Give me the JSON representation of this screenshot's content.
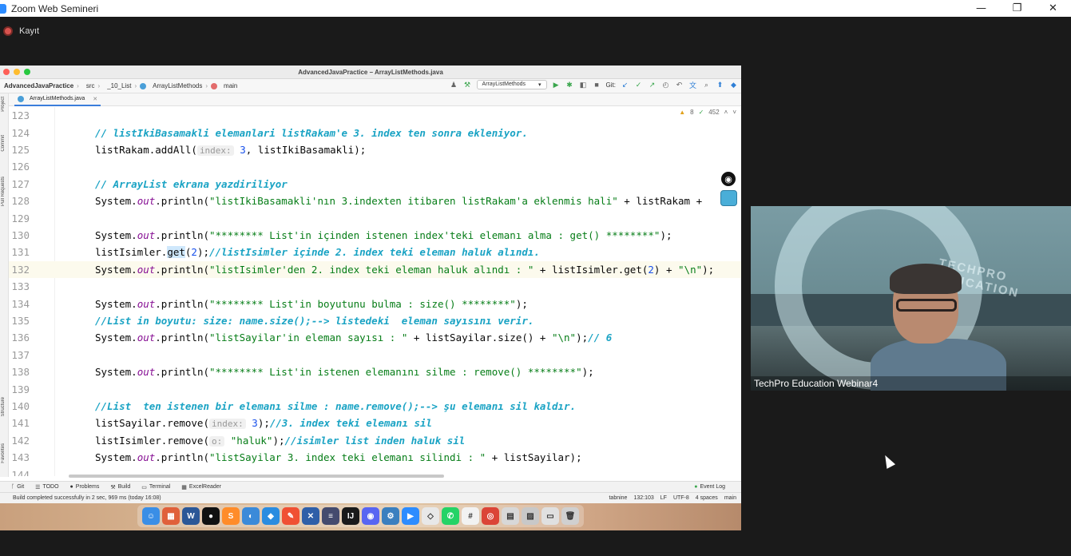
{
  "zoom": {
    "title": "Zoom Web Semineri",
    "recording_label": "Kayıt",
    "controls": [
      "—",
      "❐",
      "✕"
    ]
  },
  "ide": {
    "window_title": "AdvancedJavaPractice – ArrayListMethods.java",
    "breadcrumbs": {
      "project": "AdvancedJavaPractice",
      "src": "src",
      "package": "_10_List",
      "class": "ArrayListMethods",
      "method": "main"
    },
    "run_config": "ArrayListMethods",
    "git_label": "Git:",
    "open_tab": "ArrayListMethods.java",
    "inspections": {
      "warnings": "8",
      "ok": "452"
    },
    "left_strip": [
      "Project",
      "Commit",
      "Pull Requests",
      "Structure",
      "Favorites"
    ],
    "bottom_tabs": [
      "Git",
      "TODO",
      "Problems",
      "Build",
      "Terminal",
      "ExcelReader"
    ],
    "event_log": "Event Log",
    "status": {
      "message": "Build completed successfully in 2 sec, 969 ms (today 16:08)",
      "tabnine": "tabnine",
      "position": "132:103",
      "line_sep": "LF",
      "encoding": "UTF-8",
      "indent": "4 spaces",
      "branch": "main"
    },
    "code_lines": [
      {
        "n": "123",
        "parts": []
      },
      {
        "n": "124",
        "parts": [
          {
            "t": "// listIkiBasamakli elemanlari listRakam'e 3. index ten sonra ekleniyor.",
            "c": "cmt"
          }
        ]
      },
      {
        "n": "125",
        "parts": [
          {
            "t": "listRakam.addAll(",
            "c": ""
          },
          {
            "t": "index:",
            "c": "hint"
          },
          {
            "t": " 3",
            "c": "num"
          },
          {
            "t": ", listIkiBasamakli);",
            "c": ""
          }
        ]
      },
      {
        "n": "126",
        "parts": []
      },
      {
        "n": "127",
        "parts": [
          {
            "t": "// ArrayList ekrana yazdiriliyor",
            "c": "cmt"
          }
        ]
      },
      {
        "n": "128",
        "parts": [
          {
            "t": "System.",
            "c": ""
          },
          {
            "t": "out",
            "c": "fld"
          },
          {
            "t": ".println(",
            "c": ""
          },
          {
            "t": "\"listIkiBasamakli'nın 3.indexten itibaren listRakam'a eklenmis hali\"",
            "c": "str"
          },
          {
            "t": " + listRakam +",
            "c": ""
          }
        ]
      },
      {
        "n": "129",
        "parts": []
      },
      {
        "n": "130",
        "parts": [
          {
            "t": "System.",
            "c": ""
          },
          {
            "t": "out",
            "c": "fld"
          },
          {
            "t": ".println(",
            "c": ""
          },
          {
            "t": "\"******** List'in içinden istenen index'teki elemanı alma : get() ********\"",
            "c": "str"
          },
          {
            "t": ");",
            "c": ""
          }
        ]
      },
      {
        "n": "131",
        "parts": [
          {
            "t": "listIsimler.",
            "c": ""
          },
          {
            "t": "get",
            "c": "paren-hl"
          },
          {
            "t": "(",
            "c": ""
          },
          {
            "t": "2",
            "c": "num"
          },
          {
            "t": ");",
            "c": ""
          },
          {
            "t": "//listIsimler içinde 2. index teki eleman haluk alındı.",
            "c": "cmt"
          }
        ]
      },
      {
        "n": "132",
        "parts": [
          {
            "t": "System.",
            "c": ""
          },
          {
            "t": "out",
            "c": "fld"
          },
          {
            "t": ".println(",
            "c": ""
          },
          {
            "t": "\"listIsimler'den 2. index teki eleman haluk alındı : \"",
            "c": "str"
          },
          {
            "t": " + listIsimler.get(",
            "c": ""
          },
          {
            "t": "2",
            "c": "num"
          },
          {
            "t": ") + ",
            "c": ""
          },
          {
            "t": "\"\\n\"",
            "c": "str"
          },
          {
            "t": ");",
            "c": ""
          }
        ]
      },
      {
        "n": "133",
        "parts": []
      },
      {
        "n": "134",
        "parts": [
          {
            "t": "System.",
            "c": ""
          },
          {
            "t": "out",
            "c": "fld"
          },
          {
            "t": ".println(",
            "c": ""
          },
          {
            "t": "\"******** List'in boyutunu bulma : size() ********\"",
            "c": "str"
          },
          {
            "t": ");",
            "c": ""
          }
        ]
      },
      {
        "n": "135",
        "parts": [
          {
            "t": "//List in boyutu: size: name.size();--> listedeki  eleman sayısını verir.",
            "c": "cmt"
          }
        ]
      },
      {
        "n": "136",
        "parts": [
          {
            "t": "System.",
            "c": ""
          },
          {
            "t": "out",
            "c": "fld"
          },
          {
            "t": ".println(",
            "c": ""
          },
          {
            "t": "\"listSayilar'in eleman sayısı : \"",
            "c": "str"
          },
          {
            "t": " + listSayilar.size() + ",
            "c": ""
          },
          {
            "t": "\"\\n\"",
            "c": "str"
          },
          {
            "t": ");",
            "c": ""
          },
          {
            "t": "// 6",
            "c": "cmt"
          }
        ]
      },
      {
        "n": "137",
        "parts": []
      },
      {
        "n": "138",
        "parts": [
          {
            "t": "System.",
            "c": ""
          },
          {
            "t": "out",
            "c": "fld"
          },
          {
            "t": ".println(",
            "c": ""
          },
          {
            "t": "\"******** List'in istenen elemanını silme : remove() ********\"",
            "c": "str"
          },
          {
            "t": ");",
            "c": ""
          }
        ]
      },
      {
        "n": "139",
        "parts": []
      },
      {
        "n": "140",
        "parts": [
          {
            "t": "//List  ten istenen bir elemanı silme : name.remove();--> şu elemanı sil kaldır.",
            "c": "cmt"
          }
        ]
      },
      {
        "n": "141",
        "parts": [
          {
            "t": "listSayilar.remove(",
            "c": ""
          },
          {
            "t": "index:",
            "c": "hint"
          },
          {
            "t": " 3",
            "c": "num"
          },
          {
            "t": ");",
            "c": ""
          },
          {
            "t": "//3. index teki elemanı sil",
            "c": "cmt"
          }
        ]
      },
      {
        "n": "142",
        "parts": [
          {
            "t": "listIsimler.remove(",
            "c": ""
          },
          {
            "t": "o:",
            "c": "hint"
          },
          {
            "t": " \"haluk\"",
            "c": "str"
          },
          {
            "t": ");",
            "c": ""
          },
          {
            "t": "//isimler list inden haluk sil",
            "c": "cmt"
          }
        ]
      },
      {
        "n": "143",
        "parts": [
          {
            "t": "System.",
            "c": ""
          },
          {
            "t": "out",
            "c": "fld"
          },
          {
            "t": ".println(",
            "c": ""
          },
          {
            "t": "\"listSayilar 3. index teki elemanı silindi : \"",
            "c": "str"
          },
          {
            "t": " + listSayilar);",
            "c": ""
          }
        ]
      },
      {
        "n": "144",
        "parts": []
      }
    ],
    "active_line": "132"
  },
  "dock_apps": [
    {
      "name": "finder",
      "color": "#3a8ee6",
      "glyph": "☺"
    },
    {
      "name": "launchpad",
      "color": "#e0603a",
      "glyph": "▦"
    },
    {
      "name": "word",
      "color": "#2b5797",
      "glyph": "W"
    },
    {
      "name": "github",
      "color": "#111111",
      "glyph": "●"
    },
    {
      "name": "sublime",
      "color": "#ff8c2a",
      "glyph": "S"
    },
    {
      "name": "remote",
      "color": "#3b8ad9",
      "glyph": "◐"
    },
    {
      "name": "vscode",
      "color": "#2a8ce0",
      "glyph": "◆"
    },
    {
      "name": "pen",
      "color": "#f05033",
      "glyph": "✎"
    },
    {
      "name": "xcode",
      "color": "#2f5fa8",
      "glyph": "✕"
    },
    {
      "name": "settings",
      "color": "#444b6e",
      "glyph": "≡"
    },
    {
      "name": "intellij",
      "color": "#1a1a1a",
      "glyph": "IJ"
    },
    {
      "name": "discord",
      "color": "#5865f2",
      "glyph": "◉"
    },
    {
      "name": "system-prefs",
      "color": "#3a7fbf",
      "glyph": "⚙"
    },
    {
      "name": "zoom",
      "color": "#2d8cff",
      "glyph": "▶"
    },
    {
      "name": "shortcut",
      "color": "#e8e8e8",
      "glyph": "◇"
    },
    {
      "name": "whatsapp",
      "color": "#25d366",
      "glyph": "✆"
    },
    {
      "name": "slack",
      "color": "#f2f2f2",
      "glyph": "#"
    },
    {
      "name": "chrome",
      "color": "#db4437",
      "glyph": "◎"
    },
    {
      "name": "screens",
      "color": "#d8d8d8",
      "glyph": "▤"
    },
    {
      "name": "photos",
      "color": "#c8c8c8",
      "glyph": "▨"
    },
    {
      "name": "finder-2",
      "color": "#e0e0e0",
      "glyph": "▭"
    },
    {
      "name": "trash",
      "color": "#d0d0d0",
      "glyph": "🗑"
    }
  ],
  "webcam": {
    "participant": "TechPro Education Webinar4",
    "background_text": "TECHPRO EDUCATION"
  }
}
